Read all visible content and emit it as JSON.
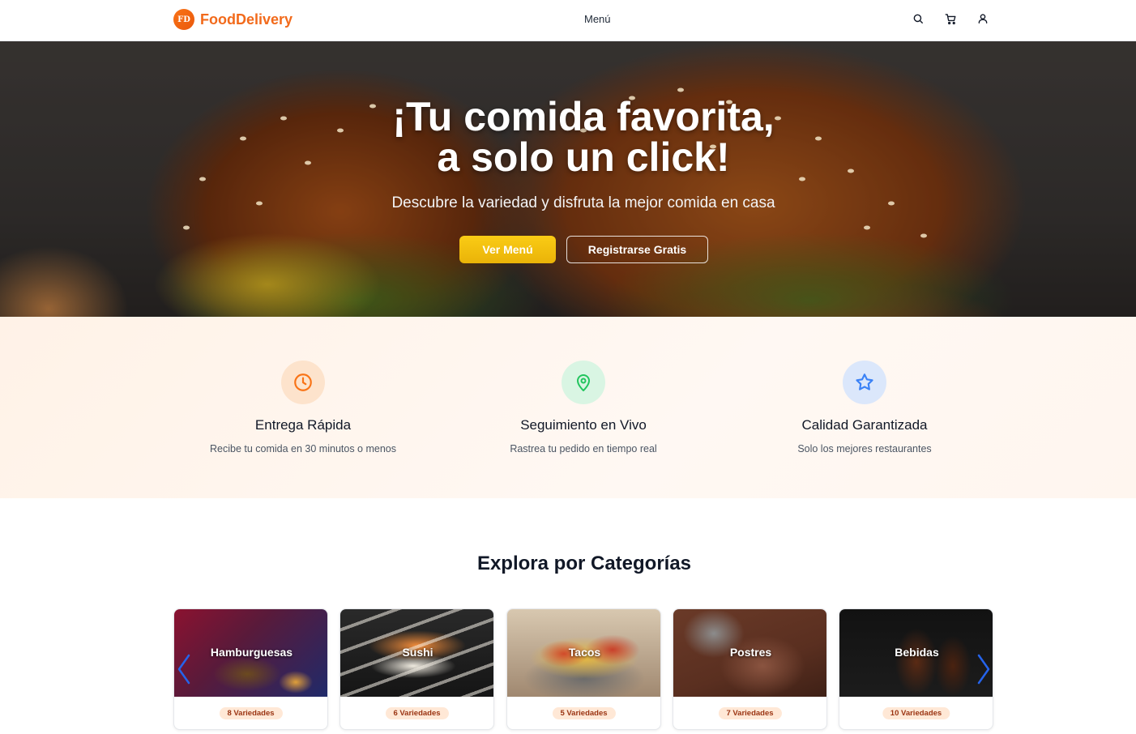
{
  "header": {
    "logo_badge": "FD",
    "logo_text": "FoodDelivery",
    "nav_menu": "Menú",
    "icons": [
      "search-icon",
      "cart-icon",
      "user-icon"
    ]
  },
  "hero": {
    "title_line1": "¡Tu comida favorita,",
    "title_line2": "a solo un click!",
    "subtitle": "Descubre la variedad y disfruta la mejor comida en casa",
    "primary_button": "Ver Menú",
    "secondary_button": "Registrarse Gratis"
  },
  "features": [
    {
      "icon": "clock-icon",
      "title": "Entrega Rápida",
      "description": "Recibe tu comida en 30 minutos o menos",
      "color": "#f97316"
    },
    {
      "icon": "map-pin-icon",
      "title": "Seguimiento en Vivo",
      "description": "Rastrea tu pedido en tiempo real",
      "color": "#22c55e"
    },
    {
      "icon": "star-icon",
      "title": "Calidad Garantizada",
      "description": "Solo los mejores restaurantes",
      "color": "#3b82f6"
    }
  ],
  "categories": {
    "title": "Explora por Categorías",
    "items": [
      {
        "name": "Hamburguesas",
        "count": "8 Variedades"
      },
      {
        "name": "Sushi",
        "count": "6 Variedades"
      },
      {
        "name": "Tacos",
        "count": "5 Variedades"
      },
      {
        "name": "Postres",
        "count": "7 Variedades"
      },
      {
        "name": "Bebidas",
        "count": "10 Variedades"
      }
    ]
  },
  "colors": {
    "brand": "#f26a1b",
    "primary_button": "#facc15",
    "badge_bg": "#ffe8d6",
    "carousel_arrow": "#2563eb"
  }
}
